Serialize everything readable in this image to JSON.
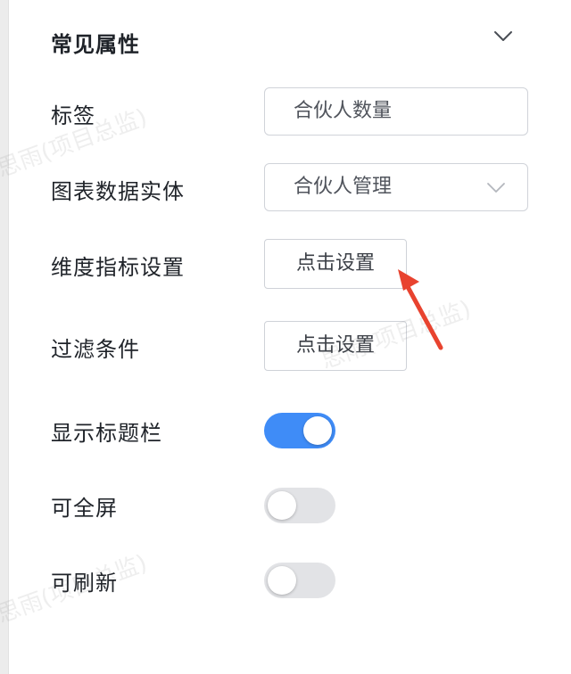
{
  "section": {
    "title": "常见属性",
    "collapse_icon": "chevron-down-icon"
  },
  "fields": {
    "tag": {
      "label": "标签",
      "value": "合伙人数量"
    },
    "entity": {
      "label": "图表数据实体",
      "value": "合伙人管理",
      "arrow_icon": "chevron-down-icon"
    },
    "metrics": {
      "label": "维度指标设置",
      "button": "点击设置"
    },
    "filter": {
      "label": "过滤条件",
      "button": "点击设置"
    },
    "show_title": {
      "label": "显示标题栏",
      "enabled": true
    },
    "fullscreen": {
      "label": "可全屏",
      "enabled": false
    },
    "refresh": {
      "label": "可刷新",
      "enabled": false
    }
  },
  "watermark": {
    "text": "思雨(项目总监)"
  },
  "colors": {
    "accent": "#3f8cf7",
    "annotation_arrow": "#e8432f",
    "switch_off": "#e2e3e6"
  }
}
